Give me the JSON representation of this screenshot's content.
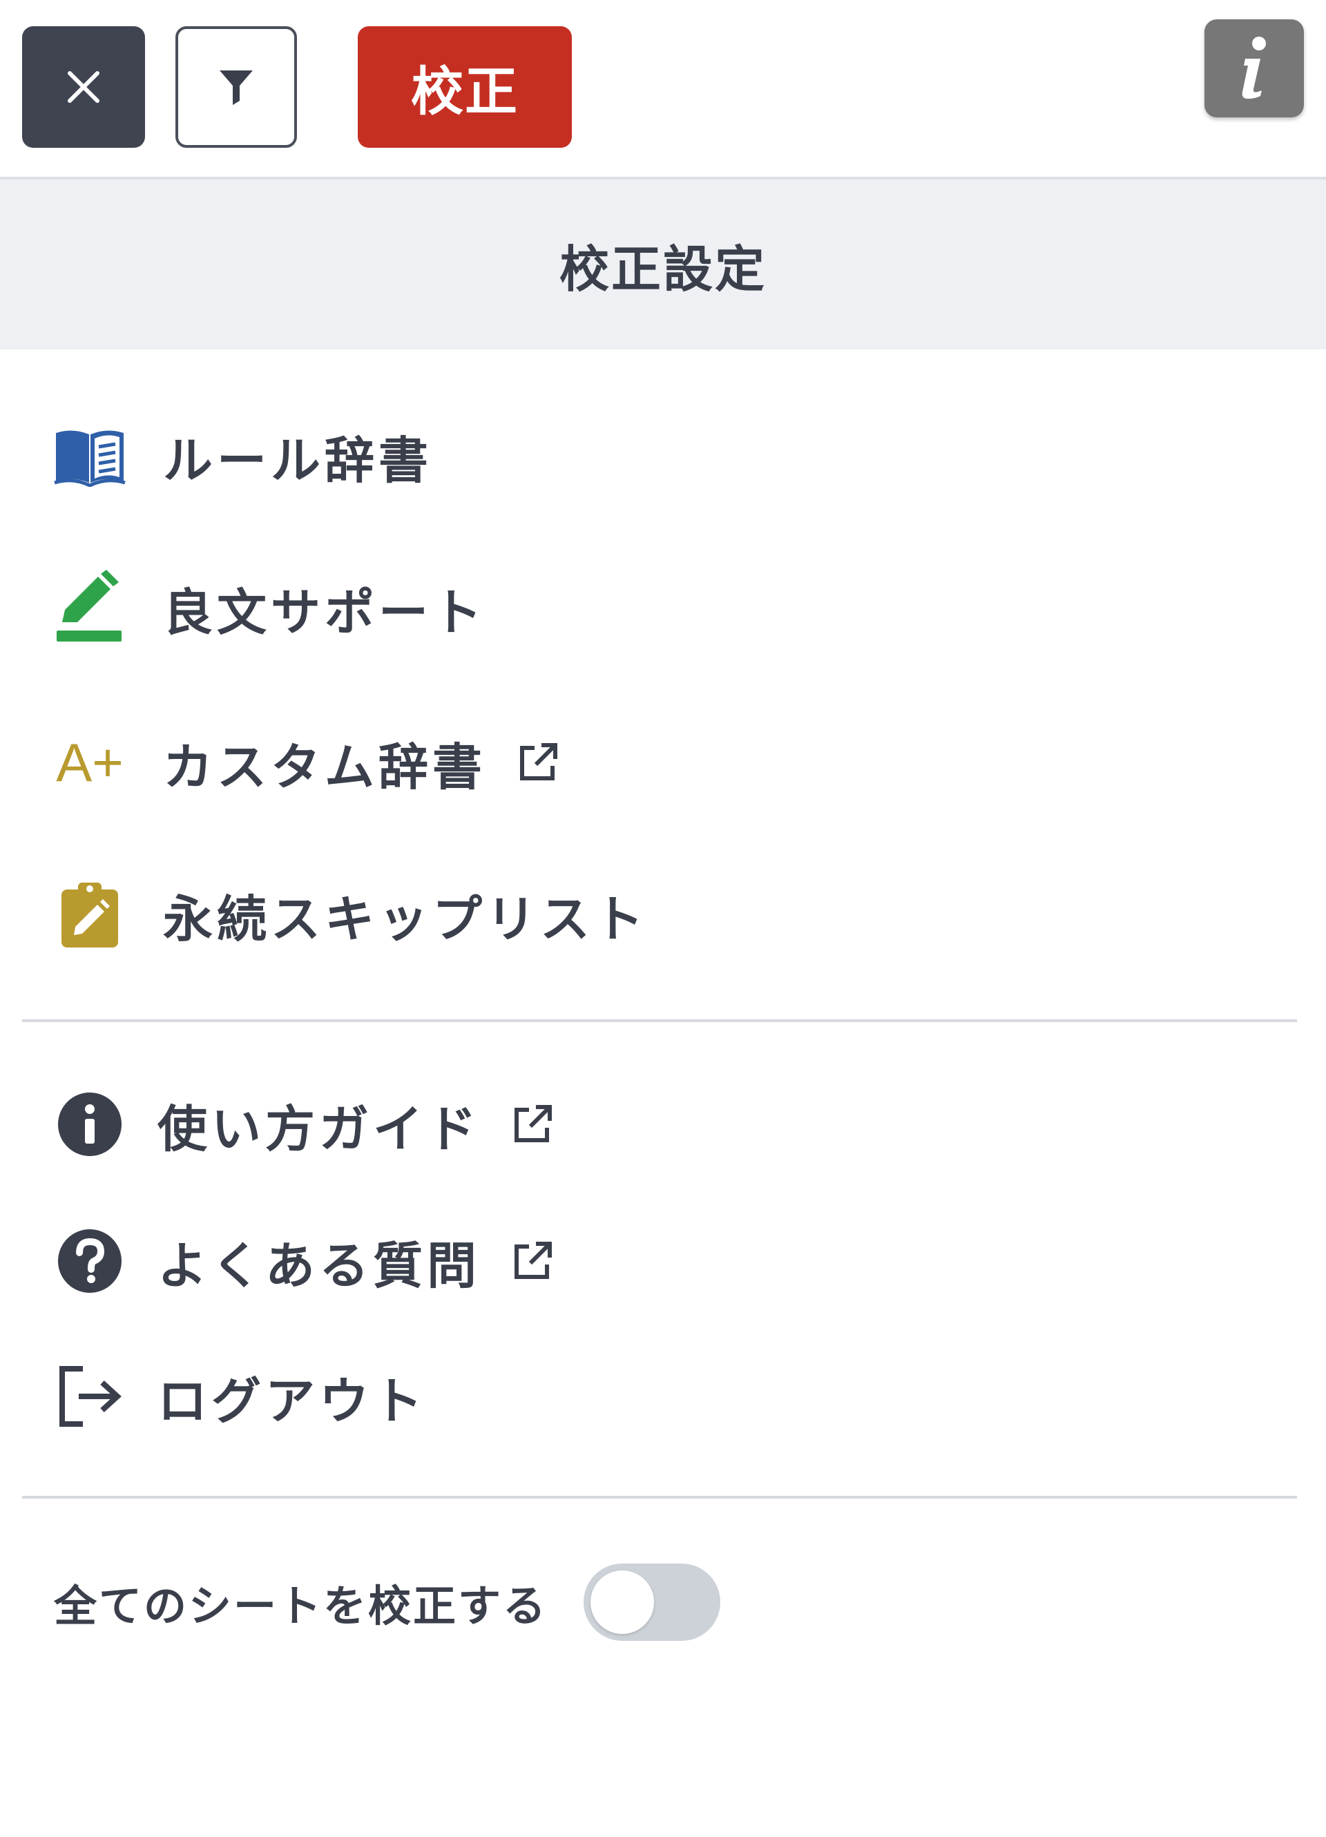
{
  "toolbar": {
    "close_icon": "close-icon",
    "filter_icon": "filter-icon",
    "proofread_label": "校正",
    "info_icon": "info-icon"
  },
  "settings": {
    "title": "校正設定"
  },
  "menu": [
    {
      "label": "ルール辞書",
      "icon": "book-icon",
      "external": false,
      "color": "#2f5fa8"
    },
    {
      "label": "良文サポート",
      "icon": "pencil-icon",
      "external": false,
      "color": "#2fa34a"
    },
    {
      "label": "カスタム辞書",
      "icon": "a-plus-icon",
      "icon_text": "A+",
      "external": true,
      "color": "#b89a2e"
    },
    {
      "label": "永続スキップリスト",
      "icon": "clipboard-edit-icon",
      "external": false,
      "color": "#b89a2e"
    }
  ],
  "help_menu": [
    {
      "label": "使い方ガイド",
      "icon": "info-circle-icon",
      "external": true
    },
    {
      "label": "よくある質問",
      "icon": "question-circle-icon",
      "external": true
    },
    {
      "label": "ログアウト",
      "icon": "logout-icon",
      "external": false
    }
  ],
  "toggle": {
    "label": "全てのシートを校正する",
    "checked": false
  },
  "colors": {
    "dark_button": "#3f4450",
    "proofread_button": "#c52f22",
    "info_button": "#777777",
    "header_bg": "#eef0f4",
    "toggle_off": "#cdd1d8"
  }
}
